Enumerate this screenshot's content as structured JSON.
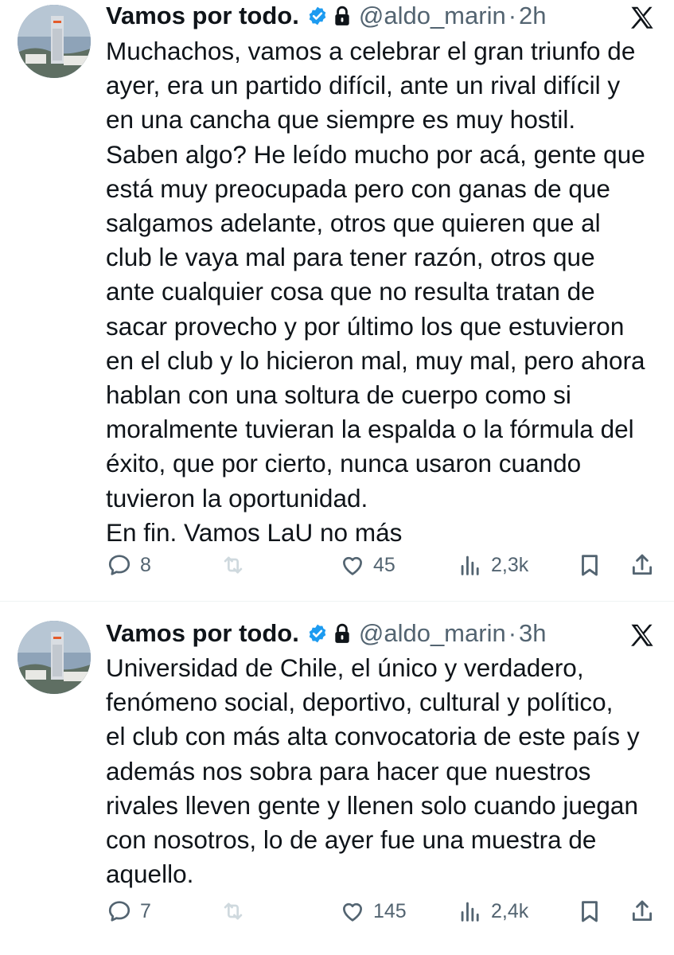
{
  "colors": {
    "text_primary": "#0f1419",
    "text_secondary": "#536471",
    "verified_blue": "#1d9bf0",
    "separator": "#eff3f4"
  },
  "icons": [
    "avatar",
    "verified-badge-icon",
    "lock-icon",
    "x-logo-icon",
    "reply-icon",
    "retweet-icon",
    "like-icon",
    "views-icon",
    "bookmark-icon",
    "share-icon"
  ],
  "tweets": [
    {
      "name": "Vamos por todo.",
      "handle": "@aldo_marin",
      "separator": "·",
      "time": "2h",
      "text": "Muchachos, vamos a celebrar el gran triunfo de\nayer, era un partido difícil, ante un rival difícil y\nen una cancha que siempre es muy hostil.\nSaben algo? He leído mucho por acá, gente que\nestá muy preocupada pero con ganas de que\nsalgamos adelante, otros que quieren que al\nclub le vaya mal para tener razón, otros que\nante cualquier cosa que no resulta tratan de\nsacar provecho y por último los que estuvieron\nen el club y lo hicieron mal, muy mal, pero ahora\nhablan con una soltura de cuerpo como si\nmoralmente tuvieran la espalda o la fórmula del\néxito, que por cierto, nunca usaron cuando\ntuvieron la oportunidad.\nEn fin. Vamos LaU no más",
      "replies": "8",
      "likes": "45",
      "views": "2,3k"
    },
    {
      "name": "Vamos por todo.",
      "handle": "@aldo_marin",
      "separator": "·",
      "time": "3h",
      "text": "Universidad de Chile, el único y verdadero,\nfenómeno social, deportivo, cultural y político,\nel club con más alta convocatoria de este país y\nademás nos sobra para hacer que nuestros\nrivales lleven gente y llenen solo cuando juegan\ncon nosotros, lo de ayer fue una muestra de\naquello.",
      "replies": "7",
      "likes": "145",
      "views": "2,4k"
    }
  ]
}
